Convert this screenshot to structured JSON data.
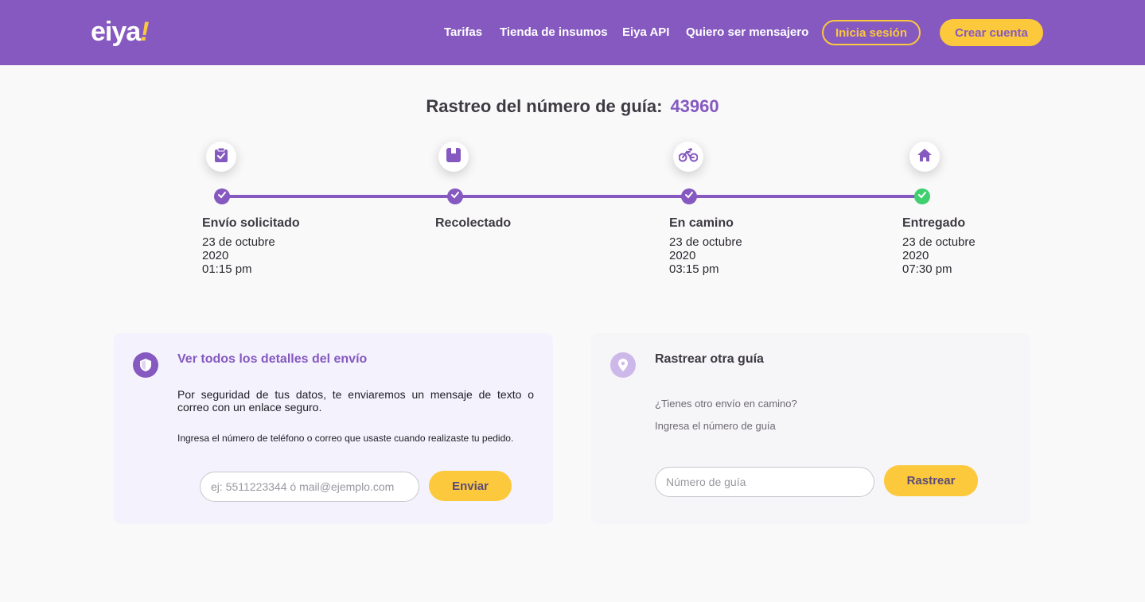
{
  "header": {
    "logo_text": "eiya",
    "logo_bang": "!",
    "nav": [
      "Tarifas",
      "Tienda de insumos",
      "Eiya API",
      "Quiero ser mensajero"
    ],
    "login_label": "Inicia sesión",
    "signup_label": "Crear cuenta"
  },
  "tracking": {
    "title": "Rastreo del número de guía:",
    "number": "43960",
    "steps": [
      {
        "label": "Envío solicitado",
        "icon": "clipboard-check-icon",
        "date_line1": "23 de octubre",
        "date_line2": "2020",
        "time": "01:15 pm",
        "status": "completed"
      },
      {
        "label": "Recolectado",
        "icon": "package-icon",
        "date_line1": "",
        "date_line2": "",
        "time": "",
        "status": "completed"
      },
      {
        "label": "En camino",
        "icon": "bicycle-icon",
        "date_line1": "23 de octubre",
        "date_line2": "2020",
        "time": "03:15 pm",
        "status": "completed"
      },
      {
        "label": "Entregado",
        "icon": "home-icon",
        "date_line1": "23 de octubre",
        "date_line2": "2020",
        "time": "07:30 pm",
        "status": "delivered"
      }
    ]
  },
  "details_card": {
    "title": "Ver todos los detalles del envío",
    "paragraph": "Por seguridad de tus datos, te enviaremos un mensaje de texto o correo con un enlace seguro.",
    "instruction": "Ingresa el número de teléfono o correo que usaste cuando realizaste tu pedido.",
    "input_placeholder": "ej: 5511223344 ó mail@ejemplo.com",
    "button_label": "Enviar"
  },
  "track_card": {
    "title": "Rastrear otra guía",
    "question": "¿Tienes otro envío en camino?",
    "instruction": "Ingresa el número de guía",
    "input_placeholder": "Número de guía",
    "button_label": "Rastrear"
  },
  "colors": {
    "brand_purple": "#8559c0",
    "accent_yellow": "#fcc83c",
    "success_green": "#3fcf6f"
  }
}
